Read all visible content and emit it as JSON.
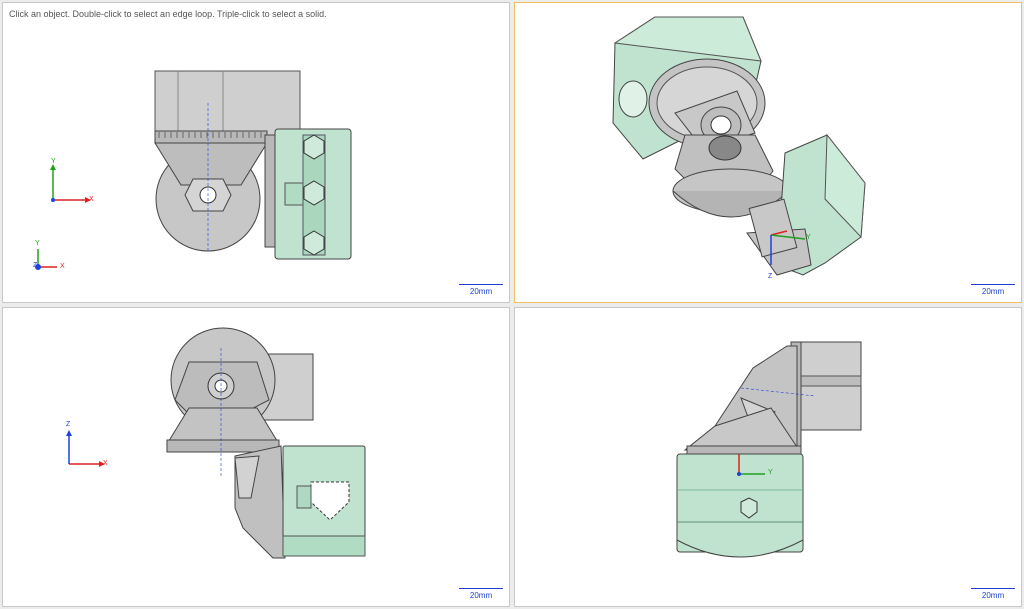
{
  "hint": "Click an object. Double-click to select an edge loop. Triple-click to select a solid.",
  "scale_label": "20mm",
  "axes": {
    "x": "X",
    "y": "Y",
    "z": "Z"
  },
  "colors": {
    "axis_x": "#e02020",
    "axis_y": "#20a020",
    "axis_z": "#2040e0",
    "part_gray": "#c4c4c4",
    "part_green": "#bfe3cf",
    "active_border": "#f0c060"
  }
}
